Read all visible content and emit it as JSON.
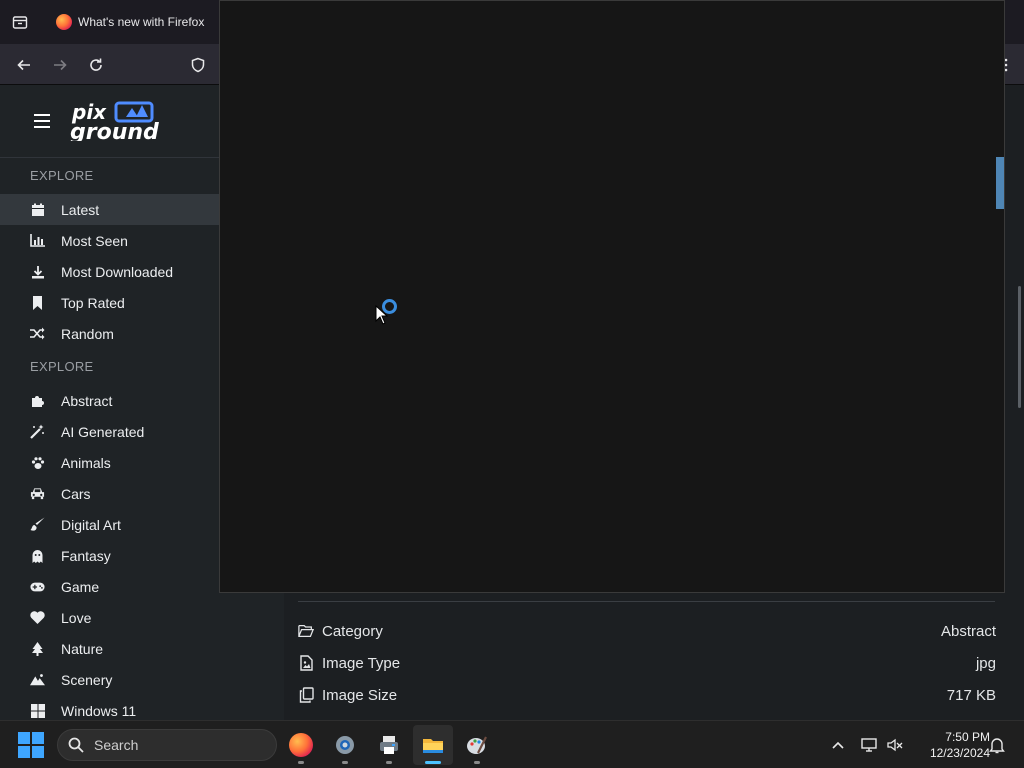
{
  "browser": {
    "tab_title": "What's new with Firefox"
  },
  "site": {
    "sections": [
      {
        "title": "EXPLORE",
        "items": [
          {
            "label": "Latest",
            "icon": "calendar-icon",
            "active": true
          },
          {
            "label": "Most Seen",
            "icon": "bar-chart-icon"
          },
          {
            "label": "Most Downloaded",
            "icon": "download-icon"
          },
          {
            "label": "Top Rated",
            "icon": "bookmark-icon"
          },
          {
            "label": "Random",
            "icon": "shuffle-icon"
          }
        ]
      },
      {
        "title": "EXPLORE",
        "items": [
          {
            "label": "Abstract",
            "icon": "puzzle-icon"
          },
          {
            "label": "AI Generated",
            "icon": "magic-wand-icon"
          },
          {
            "label": "Animals",
            "icon": "paw-icon"
          },
          {
            "label": "Cars",
            "icon": "car-icon"
          },
          {
            "label": "Digital Art",
            "icon": "brush-icon"
          },
          {
            "label": "Fantasy",
            "icon": "ghost-icon"
          },
          {
            "label": "Game",
            "icon": "gamepad-icon"
          },
          {
            "label": "Love",
            "icon": "heart-icon"
          },
          {
            "label": "Nature",
            "icon": "tree-icon"
          },
          {
            "label": "Scenery",
            "icon": "mountain-icon"
          },
          {
            "label": "Windows 11",
            "icon": "windows-icon"
          }
        ]
      }
    ]
  },
  "details": {
    "rows": [
      {
        "label": "Category",
        "value": "Abstract",
        "icon": "folder-open-icon"
      },
      {
        "label": "Image Type",
        "value": "jpg",
        "icon": "image-file-icon"
      },
      {
        "label": "Image Size",
        "value": "717 KB",
        "icon": "copy-icon"
      }
    ]
  },
  "taskbar": {
    "search_placeholder": "Search",
    "time": "7:50 PM",
    "date": "12/23/2024"
  }
}
